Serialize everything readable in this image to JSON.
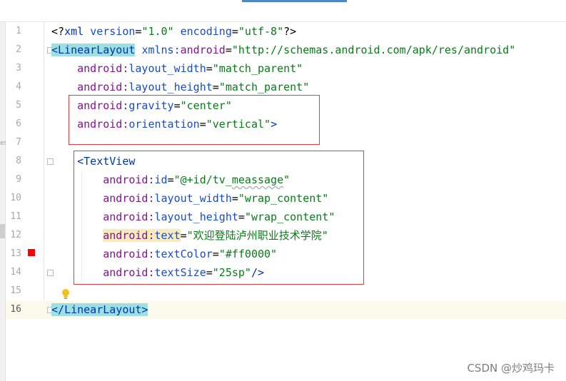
{
  "editor": {
    "line_numbers": [
      "1",
      "2",
      "3",
      "4",
      "5",
      "6",
      "7",
      "8",
      "9",
      "10",
      "11",
      "12",
      "13",
      "14",
      "15",
      "16"
    ],
    "code": {
      "l1": {
        "open": "<?",
        "tag": "xml",
        "a1": "version",
        "eq1": "=",
        "v1": "\"1.0\"",
        "a2": "encoding",
        "eq2": "=",
        "v2": "\"utf-8\"",
        "close": "?>"
      },
      "l2": {
        "open": "<",
        "tag": "LinearLayout",
        "ns": "xmlns:",
        "attr": "android",
        "eq": "=",
        "val": "\"http://schemas.android.com/apk/res/android\""
      },
      "l3": {
        "ns": "android:",
        "attr": "layout_width",
        "eq": "=",
        "val": "\"match_parent\""
      },
      "l4": {
        "ns": "android:",
        "attr": "layout_height",
        "eq": "=",
        "val": "\"match_parent\""
      },
      "l5": {
        "ns": "android:",
        "attr": "gravity",
        "eq": "=",
        "val": "\"center\""
      },
      "l6": {
        "ns": "android:",
        "attr": "orientation",
        "eq": "=",
        "val": "\"vertical\"",
        "close": ">"
      },
      "l8": {
        "open": "<",
        "tag": "TextView"
      },
      "l9": {
        "ns": "android:",
        "attr": "id",
        "eq": "=",
        "val_a": "\"@+id/tv_",
        "val_b": "meassage",
        "val_c": "\""
      },
      "l10": {
        "ns": "android:",
        "attr": "layout_width",
        "eq": "=",
        "val": "\"wrap_content\""
      },
      "l11": {
        "ns": "android:",
        "attr": "layout_height",
        "eq": "=",
        "val": "\"wrap_content\""
      },
      "l12": {
        "ns": "android:",
        "attr": "text",
        "eq": "=",
        "val": "\"欢迎登陆泸州职业技术学院\""
      },
      "l13": {
        "ns": "android:",
        "attr": "textColor",
        "eq": "=",
        "val": "\"#ff0000\""
      },
      "l14": {
        "ns": "android:",
        "attr": "textSize",
        "eq": "=",
        "val": "\"25sp\"",
        "close": "/>"
      },
      "l16": {
        "open": "</",
        "tag": "LinearLayout",
        "close": ">"
      }
    },
    "left_strip_text": "es"
  },
  "watermark": "CSDN @炒鸡玛卡",
  "colors": {
    "tag": "#0033b3",
    "namespace": "#871094",
    "attribute": "#174ad4",
    "value": "#067d17",
    "highlight_box": "#e33c3c",
    "breakpoint": "#ff0000",
    "current_line": "#fcfaed"
  },
  "icons": {
    "breakpoint": "breakpoint-icon",
    "intention": "lightbulb-icon",
    "fold": "fold-icon"
  }
}
